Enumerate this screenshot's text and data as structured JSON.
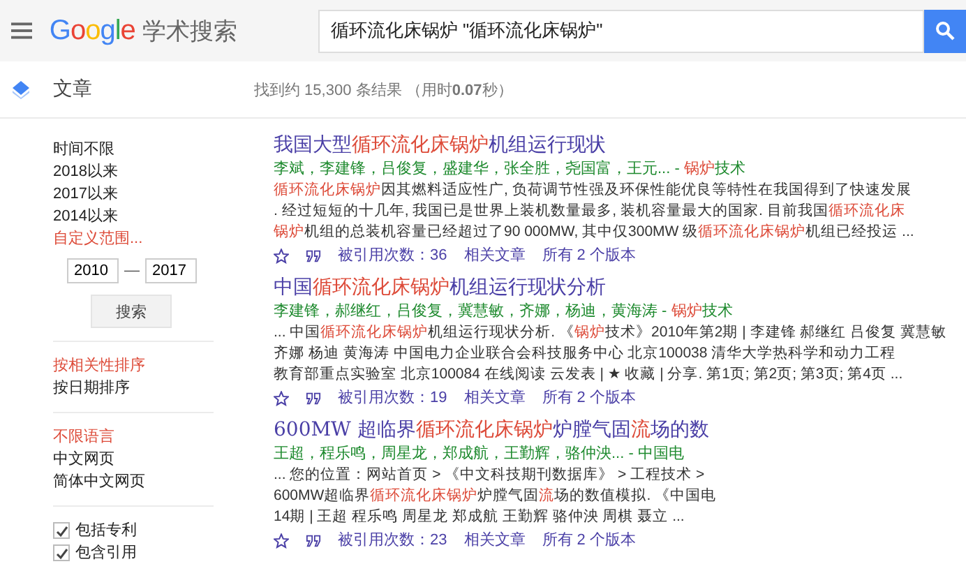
{
  "header": {
    "logo": "Google",
    "product": "学术搜索",
    "search": {
      "value": "循环流化床锅炉 \"循环流化床锅炉\""
    }
  },
  "subheader": {
    "section": "文章",
    "result_stats": "找到约 15,300 条结果 （用时**0.07**秒）"
  },
  "sidebar": {
    "time_filters": [
      {
        "label": "时间不限",
        "selected": false
      },
      {
        "label": "2018以来",
        "selected": false
      },
      {
        "label": "2017以来",
        "selected": false
      },
      {
        "label": "2014以来",
        "selected": false
      },
      {
        "label": "自定义范围...",
        "selected": true
      }
    ],
    "range": {
      "from": "2010",
      "separator": "—",
      "to": "2017",
      "button": "搜索"
    },
    "sort": [
      {
        "label": "按相关性排序",
        "selected": true
      },
      {
        "label": "按日期排序",
        "selected": false
      }
    ],
    "language": [
      {
        "label": "不限语言",
        "selected": true
      },
      {
        "label": "中文网页",
        "selected": false
      },
      {
        "label": "简体中文网页",
        "selected": false
      }
    ],
    "options": [
      {
        "label": "包括专利",
        "checked": true
      },
      {
        "label": "包含引用",
        "checked": true
      }
    ]
  },
  "results": [
    {
      "title": [
        {
          "text": "我国大型",
          "hl": false
        },
        {
          "text": "循环流化床锅炉",
          "hl": true
        },
        {
          "text": "机组运行现状",
          "hl": false
        }
      ],
      "authors": [
        {
          "text": "李斌，李建锋，吕俊复，盛建华，张全胜，尧国富，王元... - ",
          "hl": false
        },
        {
          "text": "锅炉",
          "hl": true
        },
        {
          "text": "技术",
          "hl": false
        }
      ],
      "snippet": [
        [
          {
            "text": "循环流化床锅炉",
            "hl": true
          },
          {
            "text": "因其燃料适应性广, 负荷调节性强及环保性能优良等特性在我国得到了快速发展",
            "hl": false
          }
        ],
        [
          {
            "text": ". 经过短短的十几年, 我国已是世界上装机数量最多, 装机容量最大的国家. 目前我国",
            "hl": false
          },
          {
            "text": "循环流化床",
            "hl": true
          }
        ],
        [
          {
            "text": "锅炉",
            "hl": true
          },
          {
            "text": "机组的总装机容量已经超过了90 000MW, 其中仅300MW 级",
            "hl": false
          },
          {
            "text": "循环流化床锅炉",
            "hl": true
          },
          {
            "text": "机组已经投运 ...",
            "hl": false
          }
        ]
      ],
      "cited": "被引用次数：36",
      "related": "相关文章",
      "versions": "所有 2 个版本"
    },
    {
      "title": [
        {
          "text": "中国",
          "hl": false
        },
        {
          "text": "循环流化床锅炉",
          "hl": true
        },
        {
          "text": "机组运行现状分析",
          "hl": false
        }
      ],
      "authors": [
        {
          "text": "李建锋，郝继红，吕俊复，冀慧敏，齐娜，杨迪，黄海涛 - ",
          "hl": false
        },
        {
          "text": "锅炉",
          "hl": true
        },
        {
          "text": "技术",
          "hl": false
        }
      ],
      "snippet": [
        [
          {
            "text": "... 中国",
            "hl": false
          },
          {
            "text": "循环流化床锅炉",
            "hl": true
          },
          {
            "text": "机组运行现状分析. 《",
            "hl": false
          },
          {
            "text": "锅炉",
            "hl": true
          },
          {
            "text": "技术》2010年第2期 | 李建锋 郝继红 吕俊复 冀慧敏",
            "hl": false
          }
        ],
        [
          {
            "text": "齐娜 杨迪 黄海涛 中国电力企业联合会科技服务中心 北京100038 清华大学热科学和动力工程",
            "hl": false
          }
        ],
        [
          {
            "text": "教育部重点实验室 北京100084 在线阅读 云发表 | ★ 收藏 | 分享. 第1页; 第2页; 第3页; 第4页 ...",
            "hl": false
          }
        ]
      ],
      "cited": "被引用次数：19",
      "related": "相关文章",
      "versions": "所有 2 个版本"
    },
    {
      "title": [
        {
          "text": "600MW 超临界",
          "hl": false
        },
        {
          "text": "循环流化床锅炉",
          "hl": true
        },
        {
          "text": "炉膛气固",
          "hl": false
        },
        {
          "text": "流",
          "hl": true
        },
        {
          "text": "场的数",
          "hl": false
        }
      ],
      "authors": [
        {
          "text": "王超，程乐鸣，周星龙，郑成航，王勤辉，骆仲泱... - 中国电",
          "hl": false
        }
      ],
      "snippet": [
        [
          {
            "text": "... 您的位置：网站首页 > 《中文科技期刊数据库》 > 工程技术 >",
            "hl": false
          }
        ],
        [
          {
            "text": "600MW超临界",
            "hl": false
          },
          {
            "text": "循环流化床锅炉",
            "hl": true
          },
          {
            "text": "炉膛气固",
            "hl": false
          },
          {
            "text": "流",
            "hl": true
          },
          {
            "text": "场的数值模拟. 《中国电",
            "hl": false
          }
        ],
        [
          {
            "text": "14期 | 王超 程乐鸣 周星龙 郑成航 王勤辉 骆仲泱 周棋 聂立 ...",
            "hl": false
          }
        ]
      ],
      "cited": "被引用次数：23",
      "related": "相关文章",
      "versions": "所有 2 个版本"
    }
  ]
}
